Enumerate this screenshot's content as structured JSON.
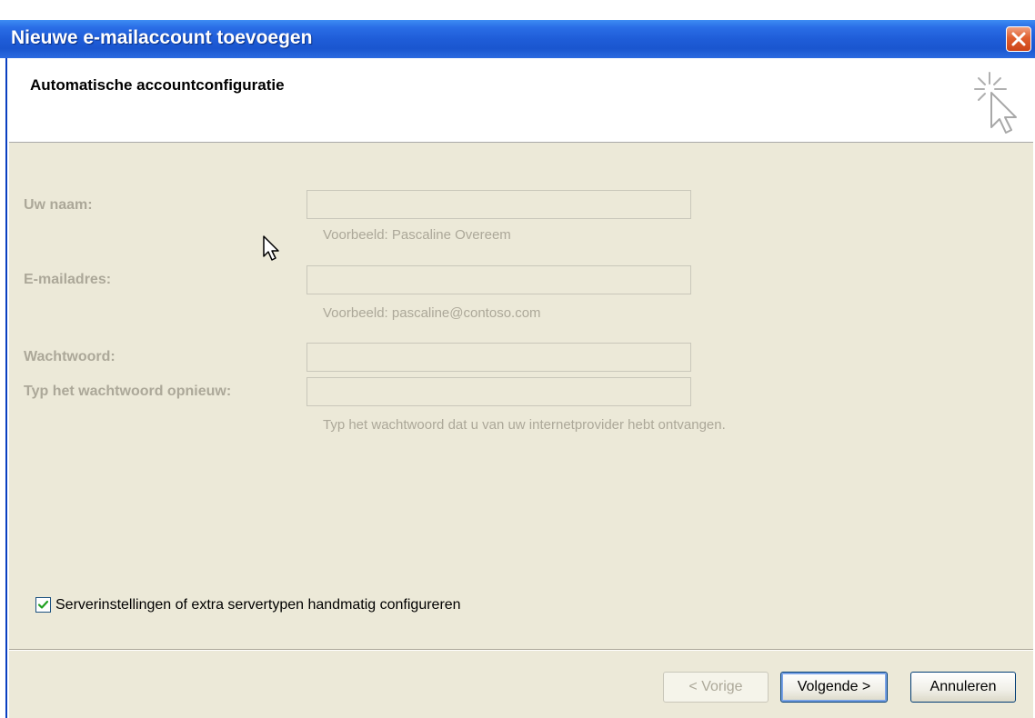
{
  "window": {
    "title": "Nieuwe e-mailaccount toevoegen"
  },
  "header": {
    "title": "Automatische accountconfiguratie",
    "icon": "cursor-sparkle-icon"
  },
  "form": {
    "name": {
      "label": "Uw naam:",
      "value": "",
      "hint": "Voorbeeld: Pascaline Overeem"
    },
    "email": {
      "label": "E-mailadres:",
      "value": "",
      "hint": "Voorbeeld: pascaline@contoso.com"
    },
    "password": {
      "label": "Wachtwoord:",
      "value": ""
    },
    "password_repeat": {
      "label": "Typ het wachtwoord opnieuw:",
      "value": "",
      "hint": "Typ het wachtwoord dat u van uw internetprovider hebt ontvangen."
    }
  },
  "manual_config": {
    "label": "Serverinstellingen of extra servertypen handmatig configureren",
    "checked": true
  },
  "buttons": {
    "back": "< Vorige",
    "next": "Volgende >",
    "cancel": "Annuleren"
  },
  "colors": {
    "titlebar": "#1f5dd8",
    "disabled_text": "#aca899",
    "dialog_bg": "#ece9d8",
    "close_button": "#e0602f"
  }
}
